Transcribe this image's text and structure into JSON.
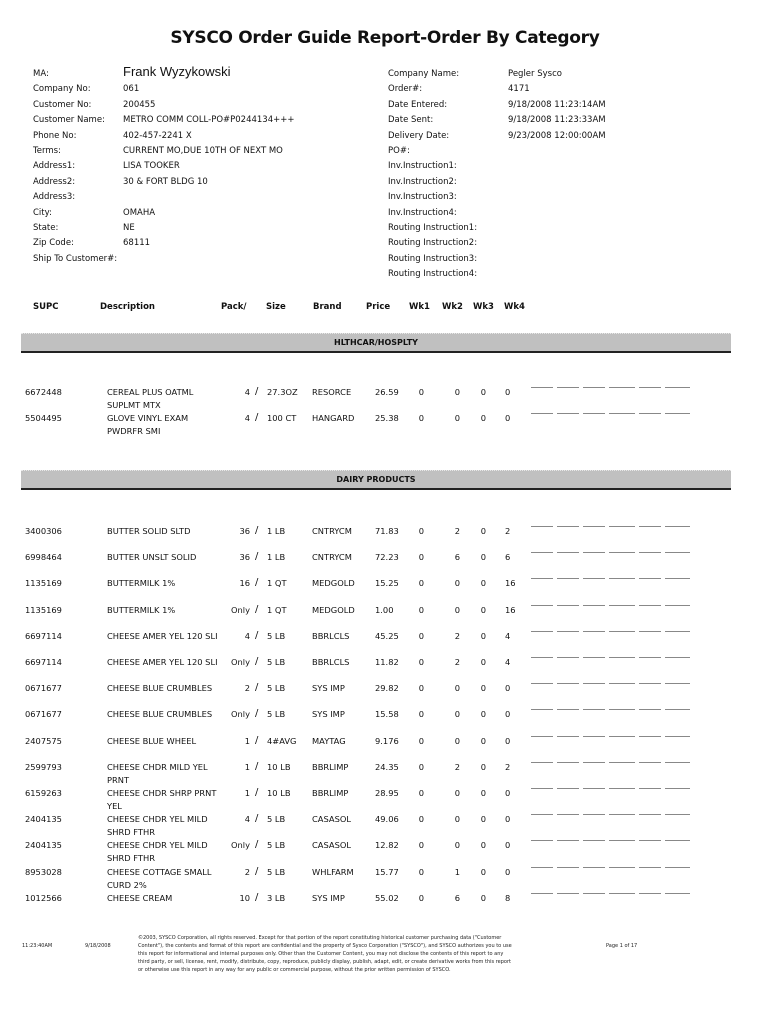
{
  "title": "SYSCO Order Guide Report-Order By Category",
  "header_left": [
    {
      "label": "MA:",
      "value": "Frank Wyzykowski"
    },
    {
      "label": "Company No:",
      "value": "061"
    },
    {
      "label": "Customer No:",
      "value": "200455"
    },
    {
      "label": "Customer Name:",
      "value": "METRO COMM COLL-PO#P0244134+++"
    },
    {
      "label": "Phone No:",
      "value": "402-457-2241 X"
    },
    {
      "label": "Terms:",
      "value": "CURRENT MO,DUE 10TH OF NEXT MO"
    },
    {
      "label": "Address1:",
      "value": "LISA TOOKER"
    },
    {
      "label": "Address2:",
      "value": "30 & FORT BLDG 10"
    },
    {
      "label": "Address3:",
      "value": ""
    },
    {
      "label": "City:",
      "value": "OMAHA"
    },
    {
      "label": "State:",
      "value": "NE"
    },
    {
      "label": "Zip Code:",
      "value": "68111"
    },
    {
      "label": "Ship To Customer#:",
      "value": ""
    }
  ],
  "header_right": [
    {
      "label": "Company Name:",
      "value": "Pegler Sysco"
    },
    {
      "label": "Order#:",
      "value": "4171"
    },
    {
      "label": "Date Entered:",
      "value": "9/18/2008  11:23:14AM"
    },
    {
      "label": "Date Sent:",
      "value": "9/18/2008  11:23:33AM"
    },
    {
      "label": "Delivery Date:",
      "value": "9/23/2008  12:00:00AM"
    },
    {
      "label": "PO#:",
      "value": ""
    },
    {
      "label": "Inv.Instruction1:",
      "value": ""
    },
    {
      "label": "Inv.Instruction2:",
      "value": ""
    },
    {
      "label": "Inv.Instruction3:",
      "value": ""
    },
    {
      "label": "Inv.Instruction4:",
      "value": ""
    },
    {
      "label": "Routing Instruction1:",
      "value": ""
    },
    {
      "label": "Routing Instruction2:",
      "value": ""
    },
    {
      "label": "Routing Instruction3:",
      "value": ""
    },
    {
      "label": "Routing Instruction4:",
      "value": ""
    }
  ],
  "columns": {
    "supc": "SUPC",
    "description": "Description",
    "pack": "Pack/",
    "size": "Size",
    "brand": "Brand",
    "price": "Price",
    "wk1": "Wk1",
    "wk2": "Wk2",
    "wk3": "Wk3",
    "wk4": "Wk4"
  },
  "categories": [
    {
      "name": "HLTHCAR/HOSPLTY",
      "items": [
        {
          "supc": "6672448",
          "description": "CEREAL PLUS OATML SUPLMT MTX",
          "pack": "4",
          "size": "27.3OZ",
          "brand": "RESORCE",
          "price": "26.59",
          "wk1": "0",
          "wk2": "0",
          "wk3": "0",
          "wk4": "0"
        },
        {
          "supc": "5504495",
          "description": "GLOVE VINYL EXAM PWDRFR SMI",
          "pack": "4",
          "size": "100 CT",
          "brand": "HANGARD",
          "price": "25.38",
          "wk1": "0",
          "wk2": "0",
          "wk3": "0",
          "wk4": "0"
        }
      ]
    },
    {
      "name": "DAIRY PRODUCTS",
      "items": [
        {
          "supc": "3400306",
          "description": "BUTTER SOLID SLTD",
          "pack": "36",
          "size": "1 LB",
          "brand": "CNTRYCM",
          "price": "71.83",
          "wk1": "0",
          "wk2": "2",
          "wk3": "0",
          "wk4": "2"
        },
        {
          "supc": "6998464",
          "description": "BUTTER UNSLT SOLID",
          "pack": "36",
          "size": "1 LB",
          "brand": "CNTRYCM",
          "price": "72.23",
          "wk1": "0",
          "wk2": "6",
          "wk3": "0",
          "wk4": "6"
        },
        {
          "supc": "1135169",
          "description": "BUTTERMILK 1%",
          "pack": "16",
          "size": "1 QT",
          "brand": "MEDGOLD",
          "price": "15.25",
          "wk1": "0",
          "wk2": "0",
          "wk3": "0",
          "wk4": "16"
        },
        {
          "supc": "1135169",
          "description": "BUTTERMILK 1%",
          "pack": "Only",
          "size": "1 QT",
          "brand": "MEDGOLD",
          "price": "1.00",
          "wk1": "0",
          "wk2": "0",
          "wk3": "0",
          "wk4": "16"
        },
        {
          "supc": "6697114",
          "description": "CHEESE AMER YEL 120 SLI",
          "pack": "4",
          "size": "5 LB",
          "brand": "BBRLCLS",
          "price": "45.25",
          "wk1": "0",
          "wk2": "2",
          "wk3": "0",
          "wk4": "4"
        },
        {
          "supc": "6697114",
          "description": "CHEESE AMER YEL 120 SLI",
          "pack": "Only",
          "size": "5 LB",
          "brand": "BBRLCLS",
          "price": "11.82",
          "wk1": "0",
          "wk2": "2",
          "wk3": "0",
          "wk4": "4"
        },
        {
          "supc": "0671677",
          "description": "CHEESE BLUE CRUMBLES",
          "pack": "2",
          "size": "5 LB",
          "brand": "SYS IMP",
          "price": "29.82",
          "wk1": "0",
          "wk2": "0",
          "wk3": "0",
          "wk4": "0"
        },
        {
          "supc": "0671677",
          "description": "CHEESE BLUE CRUMBLES",
          "pack": "Only",
          "size": "5 LB",
          "brand": "SYS IMP",
          "price": "15.58",
          "wk1": "0",
          "wk2": "0",
          "wk3": "0",
          "wk4": "0"
        },
        {
          "supc": "2407575",
          "description": "CHEESE BLUE WHEEL",
          "pack": "1",
          "size": "4#AVG",
          "brand": "MAYTAG",
          "price": "9.176",
          "wk1": "0",
          "wk2": "0",
          "wk3": "0",
          "wk4": "0"
        },
        {
          "supc": "2599793",
          "description": "CHEESE CHDR MILD YEL PRNT",
          "pack": "1",
          "size": "10 LB",
          "brand": "BBRLIMP",
          "price": "24.35",
          "wk1": "0",
          "wk2": "2",
          "wk3": "0",
          "wk4": "2"
        },
        {
          "supc": "6159263",
          "description": "CHEESE CHDR SHRP PRNT YEL",
          "pack": "1",
          "size": "10 LB",
          "brand": "BBRLIMP",
          "price": "28.95",
          "wk1": "0",
          "wk2": "0",
          "wk3": "0",
          "wk4": "0"
        },
        {
          "supc": "2404135",
          "description": "CHEESE CHDR YEL MILD SHRD FTHR",
          "pack": "4",
          "size": "5 LB",
          "brand": "CASASOL",
          "price": "49.06",
          "wk1": "0",
          "wk2": "0",
          "wk3": "0",
          "wk4": "0"
        },
        {
          "supc": "2404135",
          "description": "CHEESE CHDR YEL MILD SHRD FTHR",
          "pack": "Only",
          "size": "5 LB",
          "brand": "CASASOL",
          "price": "12.82",
          "wk1": "0",
          "wk2": "0",
          "wk3": "0",
          "wk4": "0"
        },
        {
          "supc": "8953028",
          "description": "CHEESE COTTAGE SMALL CURD 2%",
          "pack": "2",
          "size": "5 LB",
          "brand": "WHLFARM",
          "price": "15.77",
          "wk1": "0",
          "wk2": "1",
          "wk3": "0",
          "wk4": "0"
        },
        {
          "supc": "1012566",
          "description": "CHEESE CREAM",
          "pack": "10",
          "size": "3 LB",
          "brand": "SYS IMP",
          "price": "55.02",
          "wk1": "0",
          "wk2": "6",
          "wk3": "0",
          "wk4": "8"
        }
      ]
    }
  ],
  "slash": "/",
  "footer": {
    "time": "11:23:40AM",
    "date": "9/18/2008",
    "copyright": "©2003, SYSCO Corporation, all rights reserved.  Except for that portion of the report constituting historical customer purchasing data (\"Customer Content\"), the contents and format of this report are confidential and the property of Sysco Corporation  (\"SYSCO\"), and SYSCO authorizes you to use this report for informational and internal purposes only.  Other than the Customer Content, you may not disclose the contents of this report to any third party, or sell, license, rent, modify, distribute, copy, reproduce, publicly display, publish, adapt, edit, or create derivative works from this report or otherwise use this report in any way for any public or commercial purpose, without the prior written permission of SYSCO.",
    "page": "Page 1 of 17"
  }
}
